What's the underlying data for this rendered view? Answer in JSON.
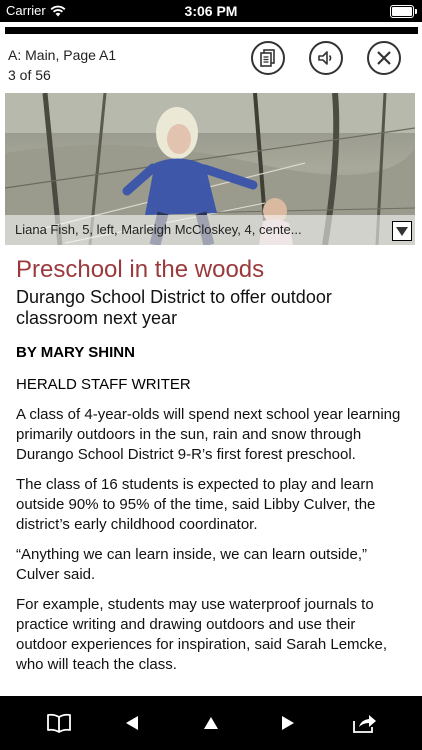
{
  "status_bar": {
    "carrier": "Carrier",
    "time": "3:06 PM",
    "icons": [
      "wifi-icon",
      "battery-icon"
    ]
  },
  "page_info": {
    "section": "A: Main, Page A1",
    "position": "3 of 56"
  },
  "toolbar": {
    "icons": [
      "pages-icon",
      "speaker-icon",
      "close-icon"
    ]
  },
  "photo": {
    "caption": "Liana Fish, 5, left, Marleigh McCloskey, 4, cente...",
    "expand_icon": "triangle-down-icon"
  },
  "article": {
    "headline": "Preschool in the woods",
    "deck": "Durango School District to offer outdoor classroom next year",
    "byline": "BY MARY SHINN",
    "staff": "HERALD STAFF WRITER",
    "paragraphs": [
      "A class of 4-year-olds will spend next school year learning primarily outdoors in the sun, rain and snow through Durango School District 9-R’s first forest preschool.",
      "The class of 16 students is expected to play and learn outside 90% to 95% of the time, said Libby Culver, the district’s early childhood coordinator.",
      "“Anything we can learn inside, we can learn outside,” Culver said.",
      "For example, students may use waterproof journals to practice writing and drawing outdoors and use their outdoor experiences for inspiration, said Sarah Lemcke, who will teach the class."
    ],
    "headline_color": "#9b3a3c"
  },
  "bottom_nav": {
    "icons": [
      "book-icon",
      "previous-icon",
      "up-icon",
      "next-icon",
      "share-icon"
    ]
  }
}
